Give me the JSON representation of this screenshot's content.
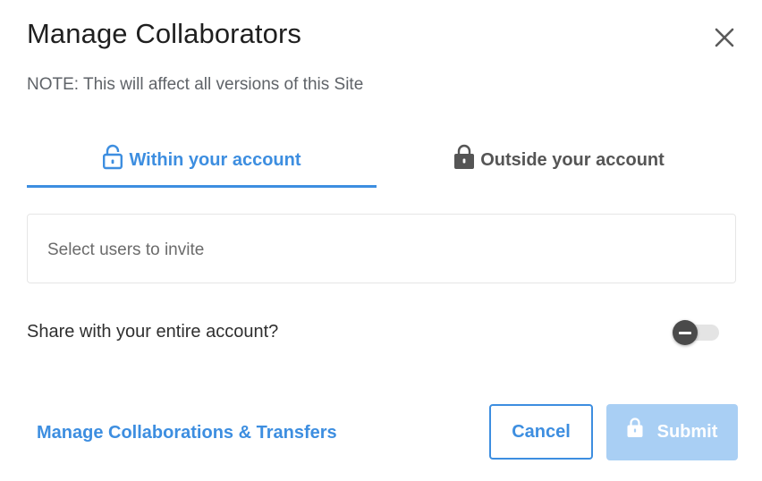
{
  "dialog": {
    "title": "Manage Collaborators",
    "note": "NOTE: This will affect all versions of this Site",
    "close_icon": "close-icon"
  },
  "tabs": [
    {
      "label": "Within your account",
      "icon": "lock-open-icon",
      "active": true
    },
    {
      "label": "Outside your account",
      "icon": "lock-icon",
      "active": false
    }
  ],
  "invite": {
    "placeholder": "Select users to invite"
  },
  "share": {
    "label": "Share with your entire account?",
    "enabled": false
  },
  "footer": {
    "manage_link": "Manage Collaborations & Transfers",
    "cancel_label": "Cancel",
    "submit_label": "Submit",
    "submit_icon": "lock-icon",
    "submit_disabled": true
  },
  "colors": {
    "accent": "#3d8ee0",
    "submit_disabled_bg": "#a9cff4",
    "toggle_knob": "#4a4a4a",
    "toggle_track": "#e4e4e4",
    "title": "#1f1f1f",
    "muted_text": "#5f6368"
  }
}
